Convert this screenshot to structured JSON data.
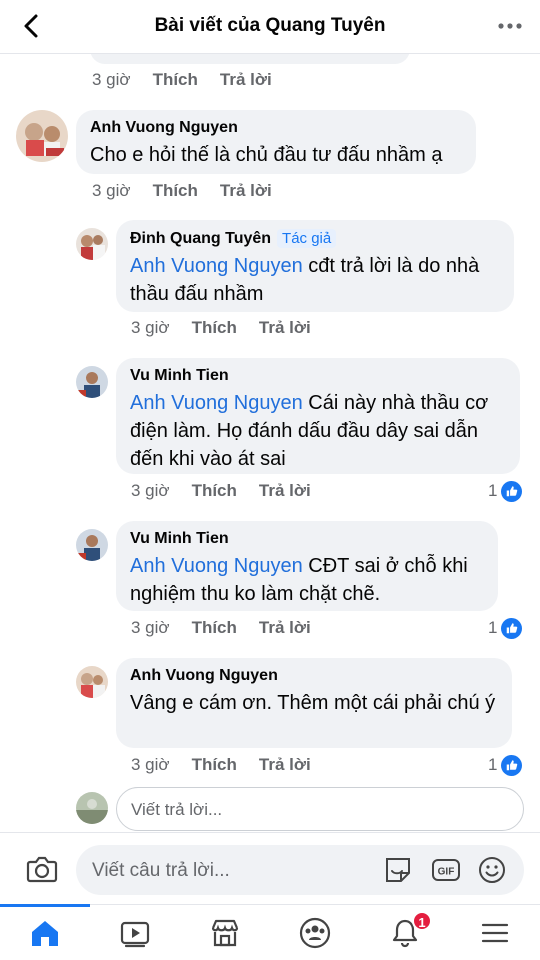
{
  "header": {
    "title": "Bài viết của Quang Tuyên"
  },
  "top_meta": {
    "time": "3 giờ",
    "like": "Thích",
    "reply": "Trả lời"
  },
  "comments": [
    {
      "author": "Anh Vuong Nguyen",
      "text": "Cho e hỏi thế là chủ đầu tư đấu nhầm ạ",
      "time": "3 giờ",
      "like": "Thích",
      "reply": "Trả lời"
    },
    {
      "author": "Đinh Quang Tuyên",
      "badge": "Tác giả",
      "mention": "Anh Vuong Nguyen",
      "text": " cđt trả lời là do nhà thầu đấu nhầm",
      "time": "3 giờ",
      "like": "Thích",
      "reply": "Trả lời"
    },
    {
      "author": "Vu Minh Tien",
      "mention": "Anh Vuong Nguyen",
      "text": " Cái này nhà thầu cơ điện làm. Họ đánh dấu đầu dây sai dẫn đến khi vào át sai",
      "time": "3 giờ",
      "like": "Thích",
      "reply": "Trả lời",
      "like_count": "1"
    },
    {
      "author": "Vu Minh Tien",
      "mention": "Anh Vuong Nguyen",
      "text": " CĐT sai ở chỗ khi nghiệm thu ko làm chặt chẽ.",
      "time": "3 giờ",
      "like": "Thích",
      "reply": "Trả lời",
      "like_count": "1"
    },
    {
      "author": "Anh Vuong Nguyen",
      "text": "Vâng e cám ơn. Thêm một cái phải chú ý",
      "time": "3 giờ",
      "like": "Thích",
      "reply": "Trả lời",
      "like_count": "1"
    }
  ],
  "reply_box": {
    "placeholder": "Viết trả lời..."
  },
  "composer": {
    "placeholder": "Viết câu trả lời..."
  },
  "tabbar": {
    "notification_count": "1"
  },
  "colors": {
    "accent": "#1877f2",
    "badge": "#e41e3f",
    "mention": "#216fdb",
    "bubble": "#f0f2f5"
  }
}
